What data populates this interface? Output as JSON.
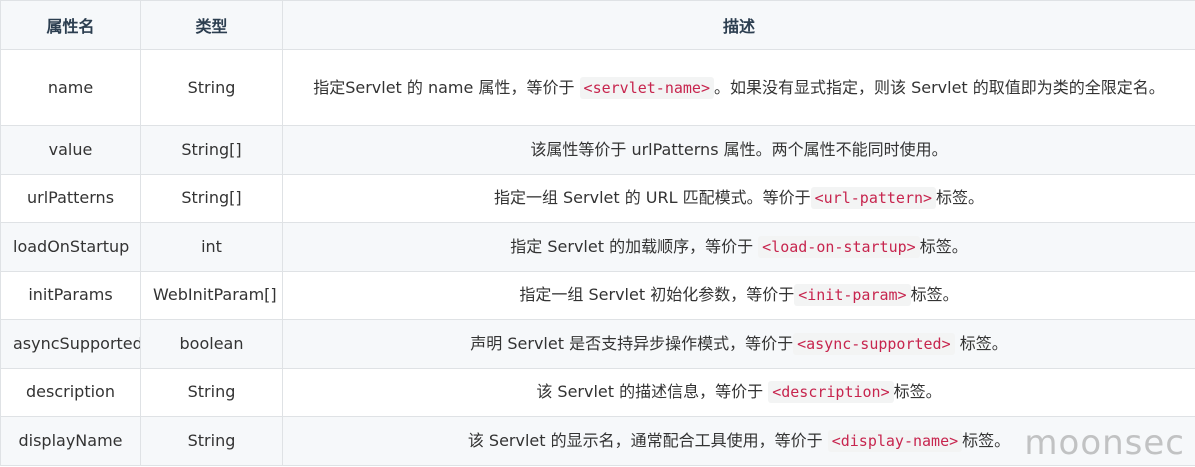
{
  "headers": [
    "属性名",
    "类型",
    "描述"
  ],
  "rows": [
    {
      "name": "name",
      "type": "String",
      "desc_before": "指定Servlet 的 name 属性，等价于 ",
      "code": "<servlet-name>",
      "desc_after": "。如果没有显式指定，则该 Servlet 的取值即为类的全限定名。"
    },
    {
      "name": "value",
      "type": "String[]",
      "desc_before": "该属性等价于 urlPatterns 属性。两个属性不能同时使用。",
      "code": "",
      "desc_after": ""
    },
    {
      "name": "urlPatterns",
      "type": "String[]",
      "desc_before": "指定一组 Servlet 的 URL 匹配模式。等价于",
      "code": "<url-pattern>",
      "desc_after": "标签。"
    },
    {
      "name": "loadOnStartup",
      "type": "int",
      "desc_before": "指定 Servlet 的加载顺序，等价于 ",
      "code": "<load-on-startup>",
      "desc_after": "标签。"
    },
    {
      "name": "initParams",
      "type": "WebInitParam[]",
      "desc_before": "指定一组 Servlet 初始化参数，等价于",
      "code": "<init-param>",
      "desc_after": "标签。"
    },
    {
      "name": "asyncSupported",
      "type": "boolean",
      "desc_before": "声明 Servlet 是否支持异步操作模式，等价于",
      "code": "<async-supported>",
      "desc_after": " 标签。"
    },
    {
      "name": "description",
      "type": "String",
      "desc_before": "该 Servlet 的描述信息，等价于 ",
      "code": "<description>",
      "desc_after": "标签。"
    },
    {
      "name": "displayName",
      "type": "String",
      "desc_before": "该 Servlet 的显示名，通常配合工具使用，等价于 ",
      "code": "<display-name>",
      "desc_after": "标签。"
    }
  ],
  "watermark": "moonsec"
}
